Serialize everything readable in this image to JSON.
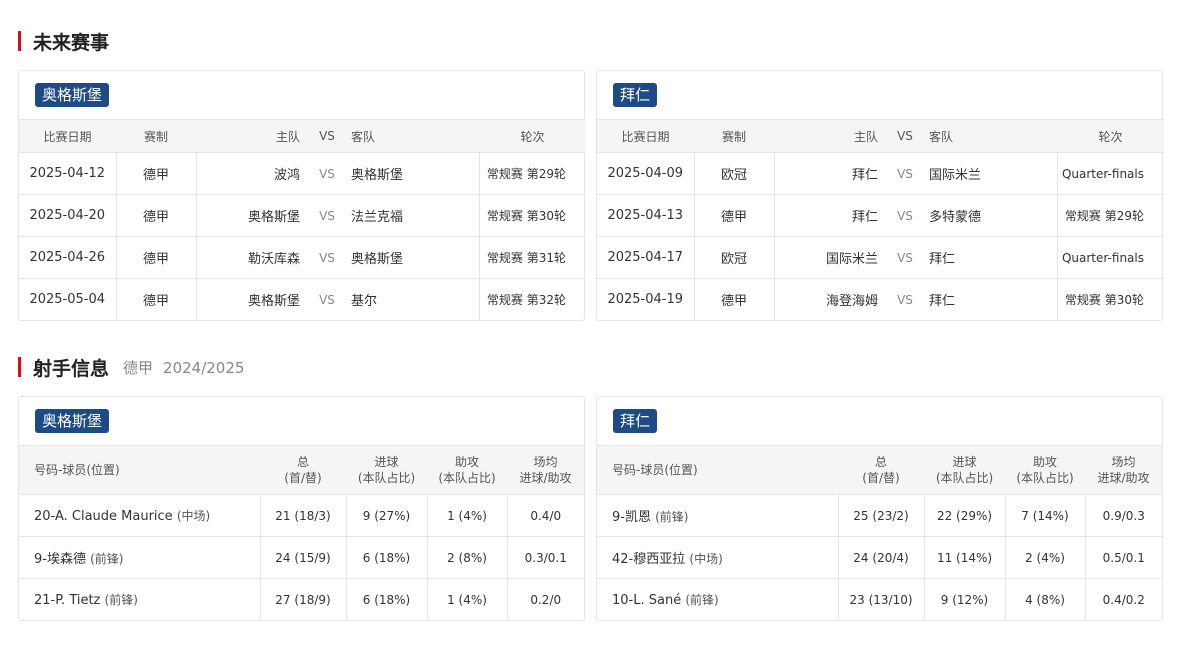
{
  "upcoming": {
    "title": "未来赛事",
    "headers": {
      "date": "比赛日期",
      "competition": "赛制",
      "home": "主队",
      "vs": "VS",
      "away": "客队",
      "round": "轮次"
    },
    "teams": [
      {
        "name": "奥格斯堡",
        "matches": [
          {
            "date": "2025-04-12",
            "competition": "德甲",
            "home": "波鸿",
            "vs": "VS",
            "away": "奥格斯堡",
            "round": "常规赛 第29轮"
          },
          {
            "date": "2025-04-20",
            "competition": "德甲",
            "home": "奥格斯堡",
            "vs": "VS",
            "away": "法兰克福",
            "round": "常规赛 第30轮"
          },
          {
            "date": "2025-04-26",
            "competition": "德甲",
            "home": "勒沃库森",
            "vs": "VS",
            "away": "奥格斯堡",
            "round": "常规赛 第31轮"
          },
          {
            "date": "2025-05-04",
            "competition": "德甲",
            "home": "奥格斯堡",
            "vs": "VS",
            "away": "基尔",
            "round": "常规赛 第32轮"
          }
        ]
      },
      {
        "name": "拜仁",
        "matches": [
          {
            "date": "2025-04-09",
            "competition": "欧冠",
            "home": "拜仁",
            "vs": "VS",
            "away": "国际米兰",
            "round": "Quarter-finals"
          },
          {
            "date": "2025-04-13",
            "competition": "德甲",
            "home": "拜仁",
            "vs": "VS",
            "away": "多特蒙德",
            "round": "常规赛 第29轮"
          },
          {
            "date": "2025-04-17",
            "competition": "欧冠",
            "home": "国际米兰",
            "vs": "VS",
            "away": "拜仁",
            "round": "Quarter-finals"
          },
          {
            "date": "2025-04-19",
            "competition": "德甲",
            "home": "海登海姆",
            "vs": "VS",
            "away": "拜仁",
            "round": "常规赛 第30轮"
          }
        ]
      }
    ]
  },
  "scorers": {
    "title": "射手信息",
    "league": "德甲",
    "season": "2024/2025",
    "headers": {
      "player": "号码-球员(位置)",
      "total": "总",
      "total_sub": "(首/替)",
      "goals": "进球",
      "goals_sub": "(本队占比)",
      "assists": "助攻",
      "assists_sub": "(本队占比)",
      "avg": "场均",
      "avg_sub": "进球/助攻"
    },
    "teams": [
      {
        "name": "奥格斯堡",
        "players": [
          {
            "num": "20-",
            "name": "A. Claude Maurice",
            "pos": "(中场)",
            "total": "21 (18/3)",
            "goals": "9 (27%)",
            "assists": "1 (4%)",
            "avg": "0.4/0"
          },
          {
            "num": "9-",
            "name": "埃森德",
            "pos": "(前锋)",
            "total": "24 (15/9)",
            "goals": "6 (18%)",
            "assists": "2 (8%)",
            "avg": "0.3/0.1"
          },
          {
            "num": "21-",
            "name": "P. Tietz",
            "pos": "(前锋)",
            "total": "27 (18/9)",
            "goals": "6 (18%)",
            "assists": "1 (4%)",
            "avg": "0.2/0"
          }
        ]
      },
      {
        "name": "拜仁",
        "players": [
          {
            "num": "9-",
            "name": "凯恩",
            "pos": "(前锋)",
            "total": "25 (23/2)",
            "goals": "22 (29%)",
            "assists": "7 (14%)",
            "avg": "0.9/0.3"
          },
          {
            "num": "42-",
            "name": "穆西亚拉",
            "pos": "(中场)",
            "total": "24 (20/4)",
            "goals": "11 (14%)",
            "assists": "2 (4%)",
            "avg": "0.5/0.1"
          },
          {
            "num": "10-",
            "name": "L. Sané",
            "pos": "(前锋)",
            "total": "23 (13/10)",
            "goals": "9 (12%)",
            "assists": "4 (8%)",
            "avg": "0.4/0.2"
          }
        ]
      }
    ]
  }
}
